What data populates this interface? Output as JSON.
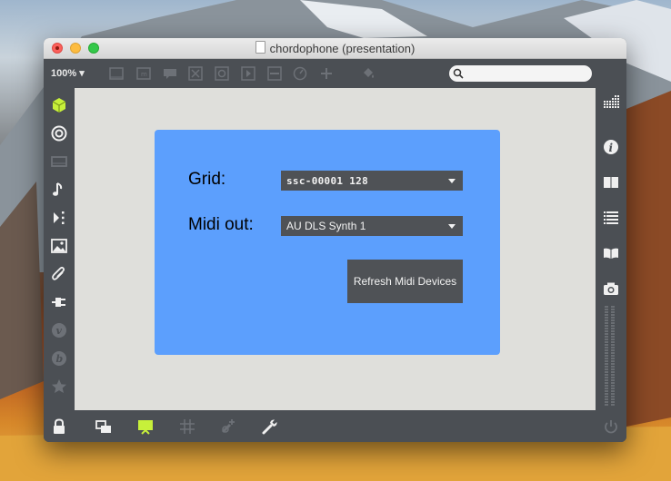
{
  "window": {
    "title": "chordophone (presentation)"
  },
  "toolbar": {
    "zoom": "100%",
    "icons": [
      "presentation-window-icon",
      "comment-box-icon",
      "speech-bubble-icon",
      "close-box-icon",
      "circle-button-icon",
      "play-button-icon",
      "slider-icon",
      "dial-icon",
      "plus-icon",
      "paint-bucket-icon"
    ],
    "search": {
      "value": "",
      "placeholder": ""
    }
  },
  "panel": {
    "grid_label": "Grid:",
    "grid_value": "ssc-00001 128",
    "midi_label": "Midi out:",
    "midi_value": "AU DLS Synth 1",
    "refresh_label": "Refresh Midi Devices",
    "background_color": "#5c9ffd"
  },
  "left_sidebar": [
    "new-object-icon",
    "target-icon",
    "window-icon",
    "music-note-icon",
    "playlist-icon",
    "image-icon",
    "paperclip-icon",
    "plugin-icon",
    "vst-icon",
    "b-icon",
    "star-icon"
  ],
  "right_sidebar": [
    "grid-icon",
    "info-icon",
    "book-icon",
    "list-icon",
    "open-book-icon",
    "camera-icon"
  ],
  "bottom_bar": [
    "lock-icon",
    "windows-icon",
    "presentation-icon",
    "grid-hash-icon",
    "debug-icon",
    "wrench-icon",
    "power-icon"
  ],
  "accent_color": "#c7f03a"
}
